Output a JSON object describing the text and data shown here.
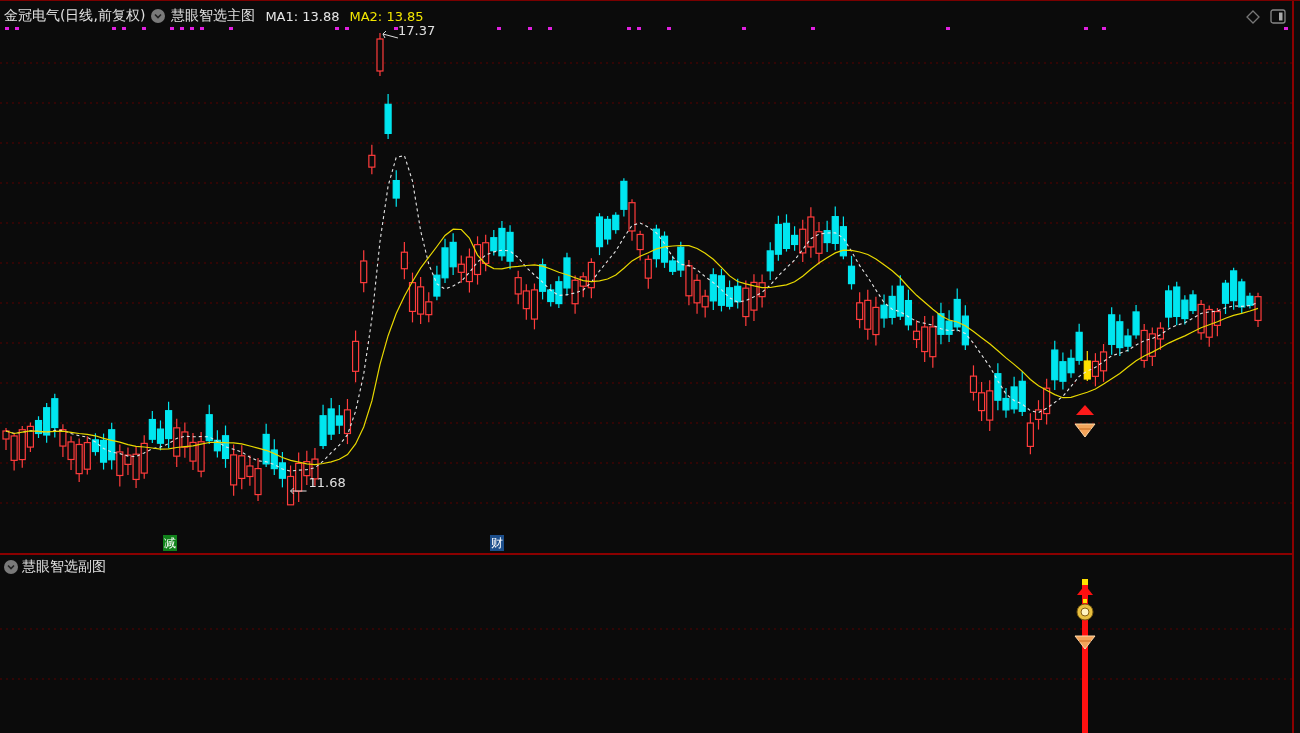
{
  "header": {
    "stock": "金冠电气(日线,前复权)",
    "indicator": "慧眼智选主图",
    "ma": [
      {
        "label": "MA1: 13.88",
        "color": "#e6e6e6"
      },
      {
        "label": "MA2: 13.85",
        "color": "#f2e600"
      }
    ]
  },
  "price_labels": [
    {
      "kind": "high",
      "text": "17.37"
    },
    {
      "kind": "low",
      "text": "11.68"
    }
  ],
  "event_tags": [
    {
      "text": "减",
      "color": "#11821b"
    },
    {
      "text": "财",
      "color": "#1d4f8c"
    }
  ],
  "sub_panel": {
    "title": "慧眼智选副图"
  }
}
